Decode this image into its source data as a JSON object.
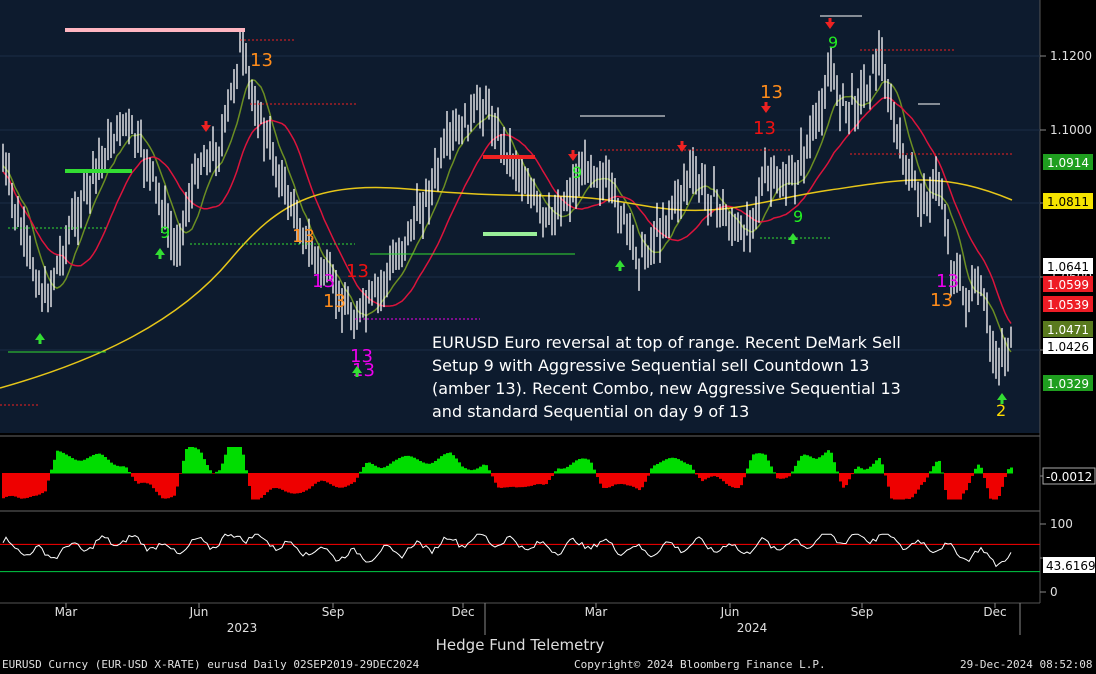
{
  "colors": {
    "price_panel_bg": "#0d1b2e",
    "positive_hist": "#00dd00",
    "negative_hist": "#ee0000",
    "ma_short": "#6b8e23",
    "ma_mid": "#dc143c",
    "ma_long": "#e6c619",
    "rsi_line": "#ffffff",
    "rsi_upper": "#ff0000",
    "rsi_lower": "#00cc44"
  },
  "annotation": "EURUSD Euro reversal at top of range.  Recent DeMark Sell Setup 9 with Aggressive Sequential sell Countdown 13 (amber 13). Recent Combo, new Aggressive Sequential 13 and standard Sequential on day 9 of 13",
  "brand_title": "Hedge Fund Telemetry",
  "footer": {
    "left": "EURUSD Curncy (EUR-USD X-RATE) eurusd  Daily 02SEP2019-29DEC2024",
    "center": "Copyright© 2024 Bloomberg Finance L.P.",
    "right": "29-Dec-2024 08:52:08"
  },
  "chart_data": [
    {
      "type": "line",
      "panel": "price",
      "y_ticks": [
        "1.1200",
        "1.1000",
        "1.0800",
        "1.0600",
        "1.0400"
      ],
      "ylim": [
        1.03,
        1.128
      ],
      "x_months": [
        "Mar",
        "Jun",
        "Sep",
        "Dec",
        "Mar",
        "Jun",
        "Sep",
        "Dec"
      ],
      "x_years": [
        "2023",
        "2024"
      ],
      "price_labels": [
        {
          "text": "1.0914",
          "color": "#1f9e1f",
          "textColor": "#ffffff"
        },
        {
          "text": "1.0811",
          "color": "#f5e400",
          "textColor": "#000000"
        },
        {
          "text": "1.0641",
          "color": "#ffffff",
          "textColor": "#000000"
        },
        {
          "text": "1.0599",
          "color": "#ee1c25",
          "textColor": "#ffffff"
        },
        {
          "text": "1.0539",
          "color": "#ee1c25",
          "textColor": "#ffffff"
        },
        {
          "text": "1.0471",
          "color": "#5a7a1e",
          "textColor": "#ffffff"
        },
        {
          "text": "1.0426",
          "color": "#ffffff",
          "textColor": "#000000"
        },
        {
          "text": "1.0329",
          "color": "#1f9e1f",
          "textColor": "#ffffff"
        }
      ],
      "demark_labels": [
        {
          "text": "9",
          "color": "#22ee22"
        },
        {
          "text": "9",
          "color": "#22ee22"
        },
        {
          "text": "9",
          "color": "#22ee22"
        },
        {
          "text": "9",
          "color": "#22ee22"
        },
        {
          "text": "13",
          "color": "#ff8c1a"
        },
        {
          "text": "13",
          "color": "#ff8c1a"
        },
        {
          "text": "13",
          "color": "#ff8c1a"
        },
        {
          "text": "13",
          "color": "#ff8c1a"
        },
        {
          "text": "13",
          "color": "#ff8c1a"
        },
        {
          "text": "13",
          "color": "#ee1111"
        },
        {
          "text": "13",
          "color": "#ee1111"
        },
        {
          "text": "13",
          "color": "#ee00ee"
        },
        {
          "text": "13",
          "color": "#ee00ee"
        },
        {
          "text": "13",
          "color": "#ee00ee"
        },
        {
          "text": "13",
          "color": "#ee00ee"
        },
        {
          "text": "2",
          "color": "#ffdd00"
        }
      ]
    },
    {
      "type": "bar",
      "panel": "oscillator",
      "last_value": "-0.0012"
    },
    {
      "type": "line",
      "panel": "rsi",
      "y_ticks": [
        "100",
        "50",
        "0"
      ],
      "ylim": [
        0,
        100
      ],
      "last_value": "43.6169"
    }
  ]
}
